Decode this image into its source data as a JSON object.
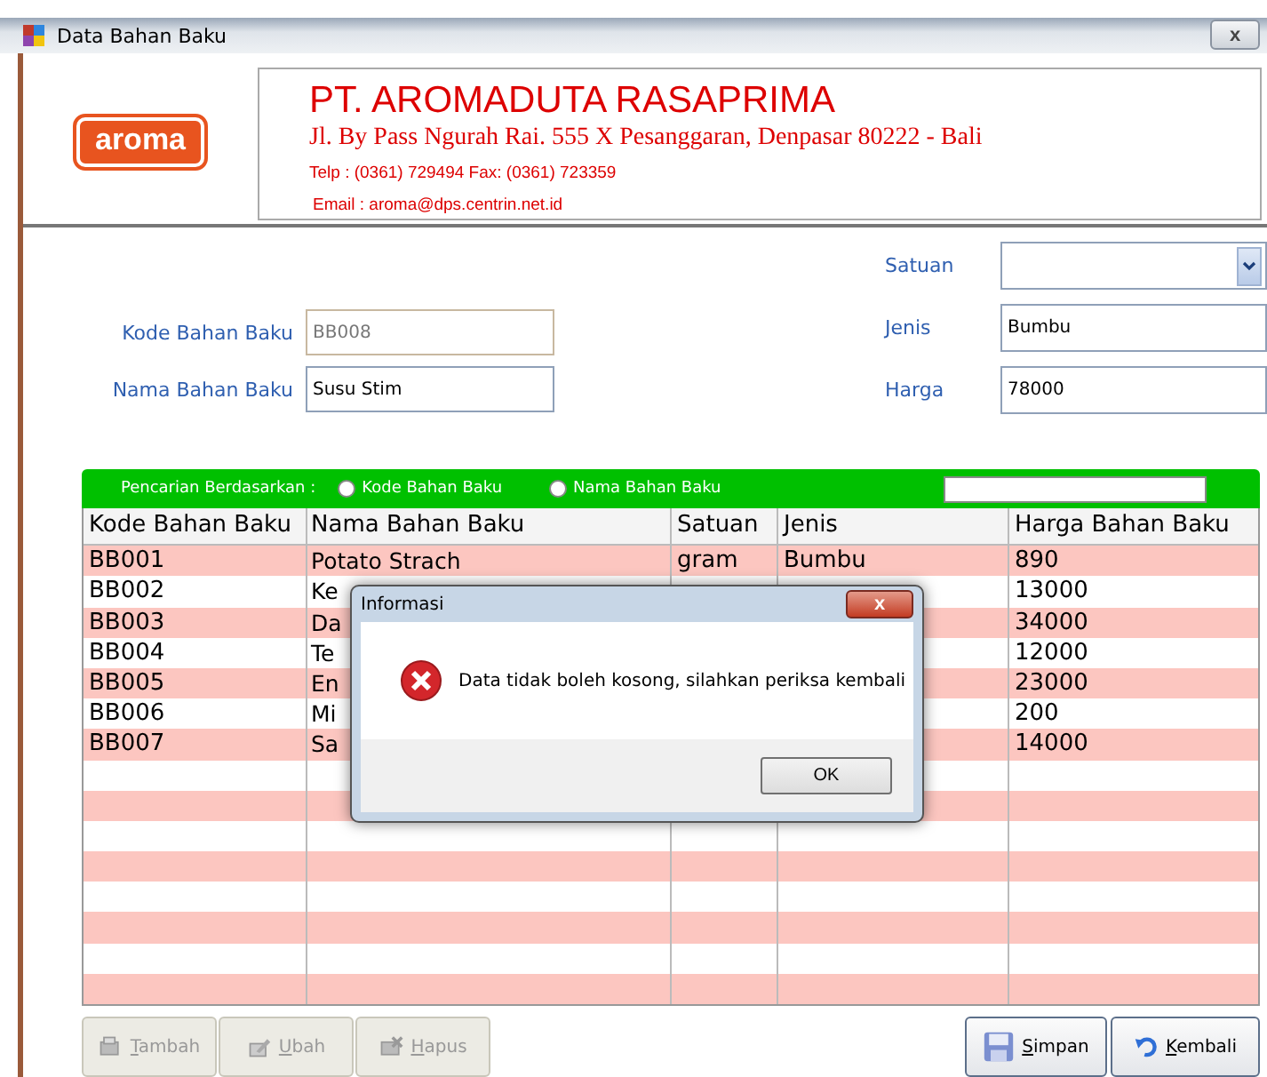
{
  "window": {
    "title": "Data Bahan Baku",
    "close": "x"
  },
  "header": {
    "logo": "aroma",
    "company": "PT. AROMADUTA RASAPRIMA",
    "address": "Jl. By Pass Ngurah Rai. 555 X Pesanggaran, Denpasar 80222 - Bali",
    "phone": "Telp : (0361) 729494   Fax: (0361) 723359",
    "email": "Email : aroma@dps.centrin.net.id"
  },
  "form_left": [
    {
      "label": "Kode Bahan Baku",
      "value": "BB008",
      "disabled": true
    },
    {
      "label": "Nama Bahan Baku",
      "value": "Susu Stim",
      "disabled": false
    }
  ],
  "form_right": [
    {
      "label": "Satuan",
      "kind": "dropdown"
    },
    {
      "label": "Jenis",
      "value": "Bumbu",
      "kind": "text"
    },
    {
      "label": "Harga",
      "value": "78000",
      "kind": "text"
    }
  ],
  "search": {
    "label": "Pencarian Berdasarkan :",
    "options": [
      {
        "label": "Kode Bahan Baku",
        "selected": false
      },
      {
        "label": "Nama Bahan Baku",
        "selected": false
      }
    ]
  },
  "table": {
    "columns": [
      "Kode Bahan Baku",
      "Nama Bahan Baku",
      "Satuan",
      "Jenis",
      "Harga Bahan Baku"
    ],
    "rows": [
      [
        "BB001",
        "Potato Strach",
        "gram",
        "Bumbu",
        "890"
      ],
      [
        "BB002",
        "Ke",
        "",
        "",
        "13000"
      ],
      [
        "BB003",
        "Da",
        "",
        "",
        "34000"
      ],
      [
        "BB004",
        "Te",
        "",
        "",
        "12000"
      ],
      [
        "BB005",
        "En",
        "",
        "",
        "23000"
      ],
      [
        "BB006",
        "Mi",
        "",
        "",
        "200"
      ],
      [
        "BB007",
        "Sa",
        "",
        "",
        "14000"
      ]
    ]
  },
  "buttons_left": [
    {
      "label": "Tambah",
      "disabled": true
    },
    {
      "label": "Ubah",
      "disabled": true
    },
    {
      "label": "Hapus",
      "disabled": true
    }
  ],
  "buttons_right": [
    {
      "label": "Simpan",
      "disabled": false
    },
    {
      "label": "Kembali",
      "disabled": false
    }
  ],
  "dialog": {
    "title": "Informasi",
    "close": "x",
    "message": "Data tidak boleh kosong, silahkan periksa kembali",
    "button": "OK"
  }
}
